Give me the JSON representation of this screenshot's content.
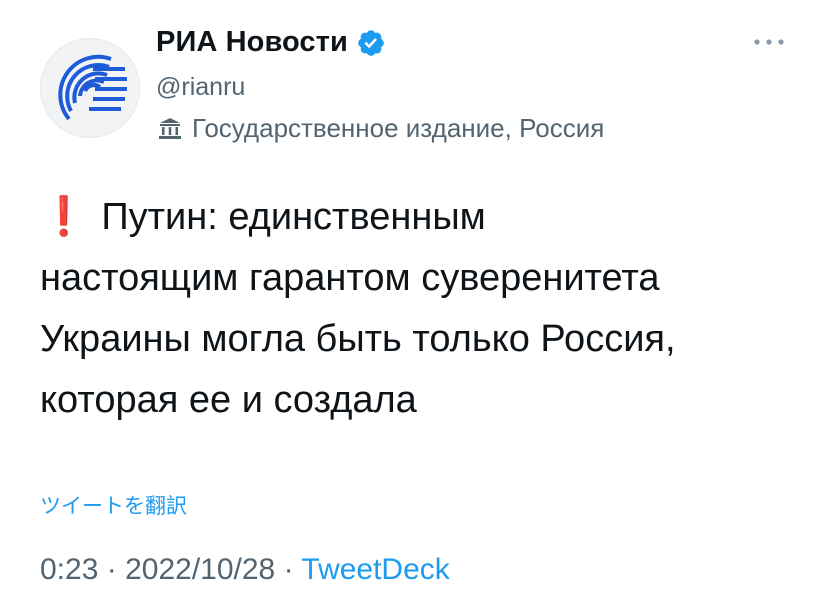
{
  "author": {
    "name": "РИА Новости",
    "handle": "@rianru",
    "verified": true,
    "label_icon": "government-building-icon",
    "label": "Государственное издание, Россия"
  },
  "tweet": {
    "alert_icon": "exclamation-icon",
    "alert_glyph": "❗",
    "lines": [
      "Путин: единственным",
      "настоящим гарантом суверенитета",
      "Украины могла быть только Россия,",
      "которая ее и создала"
    ]
  },
  "translate_link": "ツイートを翻訳",
  "meta": {
    "time": "0:23",
    "separator": "·",
    "date": "2022/10/28",
    "source": "TweetDeck"
  },
  "colors": {
    "accent": "#1d9bf0",
    "secondary_text": "#536471",
    "alert": "#e0245e",
    "logo": "#1e5bd8"
  }
}
